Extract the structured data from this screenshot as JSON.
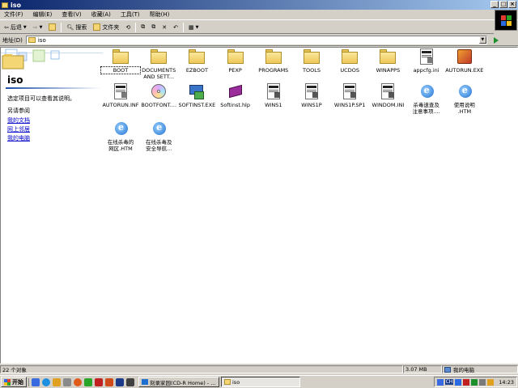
{
  "window": {
    "title": "iso"
  },
  "menu": [
    "文件(F)",
    "编辑(E)",
    "查看(V)",
    "收藏(A)",
    "工具(T)",
    "帮助(H)"
  ],
  "toolbar": {
    "back": "后退",
    "search": "搜索",
    "folders": "文件夹"
  },
  "address": {
    "label": "地址(D)",
    "value": "iso"
  },
  "sidebar": {
    "title": "iso",
    "description": "选定项目可以查看其说明。",
    "see_also": "另请参阅",
    "links": [
      "我的文档",
      "网上邻居",
      "我的电脑"
    ]
  },
  "files": [
    {
      "name": "BOOT",
      "type": "folder"
    },
    {
      "name": "DOCUMENTS\nAND SETT...",
      "type": "folder"
    },
    {
      "name": "EZBOOT",
      "type": "folder"
    },
    {
      "name": "PEXP",
      "type": "folder"
    },
    {
      "name": "PROGRAMS",
      "type": "folder"
    },
    {
      "name": "TOOLS",
      "type": "folder"
    },
    {
      "name": "UCDOS",
      "type": "folder"
    },
    {
      "name": "WINAPPS",
      "type": "folder"
    },
    {
      "name": "appcfg.ini",
      "type": "config-file"
    },
    {
      "name": "AUTORUN.EXE",
      "type": "autorun-exe"
    },
    {
      "name": "AUTORUN.INF",
      "type": "config-file"
    },
    {
      "name": "BOOTFONT....",
      "type": "disc"
    },
    {
      "name": "SOFTINST.EXE",
      "type": "setup-exe"
    },
    {
      "name": "Softinst.hlp",
      "type": "help-book"
    },
    {
      "name": "WINS1",
      "type": "system-file"
    },
    {
      "name": "WINS1P",
      "type": "system-file"
    },
    {
      "name": "WINS1P.SP1",
      "type": "system-file"
    },
    {
      "name": "WINDOM.INI",
      "type": "system-file"
    },
    {
      "name": "杀毒速查及\n注意事项....",
      "type": "ie-document"
    },
    {
      "name": "使用说明\n.HTM",
      "type": "ie-document"
    },
    {
      "name": "在线杀毒的\n网区.HTM",
      "type": "ie-document"
    },
    {
      "name": "在线杀毒及\n安全导航...",
      "type": "ie-document"
    }
  ],
  "status": {
    "count": "22 个对象",
    "size": "3.07 MB",
    "location": "我的电脑"
  },
  "taskbar": {
    "start": "开始",
    "tasks": [
      "刻录家园(CD-R Home) - ...",
      "iso"
    ],
    "tray_lang": "CH",
    "clock": "14:23"
  },
  "colors": {
    "titlebar_start": "#0a246a",
    "titlebar_end": "#a6caf0",
    "link": "#0000cc",
    "chrome": "#d4d0c8"
  }
}
